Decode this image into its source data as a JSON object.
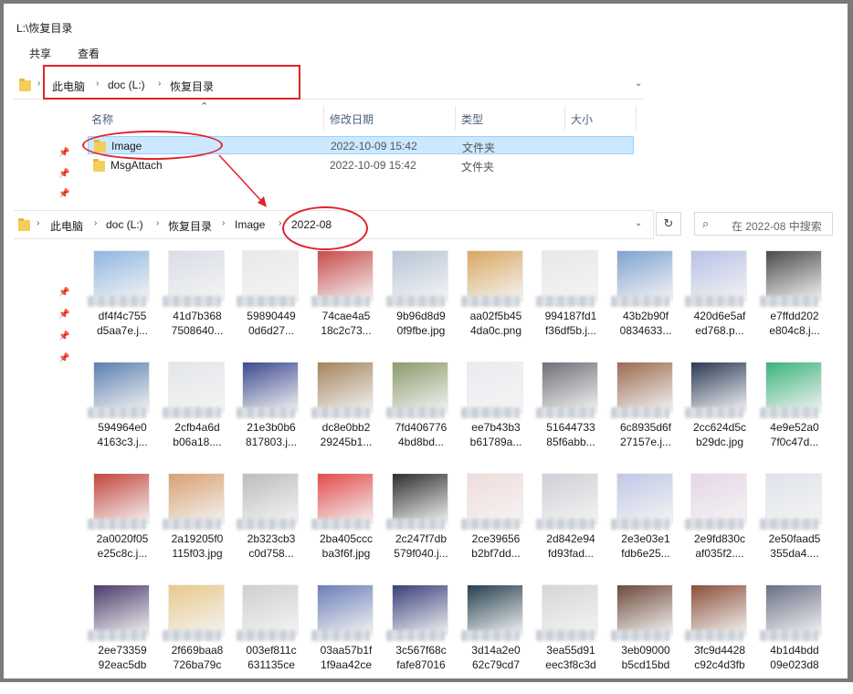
{
  "window": {
    "title": "L:\\恢复目录"
  },
  "ribbon": {
    "tabs": [
      "共享",
      "查看"
    ]
  },
  "top_address": {
    "segments": [
      "此电脑",
      "doc (L:)",
      "恢复目录"
    ]
  },
  "columns": {
    "name": "名称",
    "modified": "修改日期",
    "type": "类型",
    "size": "大小"
  },
  "files": [
    {
      "name": "Image",
      "modified": "2022-10-09 15:42",
      "type": "文件夹",
      "selected": true
    },
    {
      "name": "MsgAttach",
      "modified": "2022-10-09 15:42",
      "type": "文件夹",
      "selected": false
    }
  ],
  "bottom_address": {
    "segments": [
      "此电脑",
      "doc (L:)",
      "恢复目录",
      "Image",
      "2022-08"
    ]
  },
  "search": {
    "placeholder": "在 2022-08 中搜索"
  },
  "thumbnails": [
    {
      "l1": "df4f4c755",
      "l2": "d5aa7e.j...",
      "color": "#8fb7e0"
    },
    {
      "l1": "41d7b368",
      "l2": "7508640...",
      "color": "#d9dde6"
    },
    {
      "l1": "59890449",
      "l2": "0d6d27...",
      "color": "#e9e9e9"
    },
    {
      "l1": "74cae4a5",
      "l2": "18c2c73...",
      "color": "#c94b4b"
    },
    {
      "l1": "9b96d8d9",
      "l2": "0f9fbe.jpg",
      "color": "#b8c6d6"
    },
    {
      "l1": "aa02f5b45",
      "l2": "4da0c.png",
      "color": "#d9a861"
    },
    {
      "l1": "994187fd1",
      "l2": "f36df5b.j...",
      "color": "#e8e8e8"
    },
    {
      "l1": "43b2b90f",
      "l2": "0834633...",
      "color": "#7fa3cf"
    },
    {
      "l1": "420d6e5af",
      "l2": "ed768.p...",
      "color": "#b7c1e6"
    },
    {
      "l1": "e7ffdd202",
      "l2": "e804c8.j...",
      "color": "#4a4a4a"
    },
    {
      "l1": "594964e0",
      "l2": "4163c3.j...",
      "color": "#5c7fb0"
    },
    {
      "l1": "2cfb4a6d",
      "l2": "b06a18....",
      "color": "#e3e6ea"
    },
    {
      "l1": "21e3b0b6",
      "l2": "817803.j...",
      "color": "#3d4a8f"
    },
    {
      "l1": "dc8e0bb2",
      "l2": "29245b1...",
      "color": "#a3845c"
    },
    {
      "l1": "7fd406776",
      "l2": "4bd8bd...",
      "color": "#8b9a6a"
    },
    {
      "l1": "ee7b43b3",
      "l2": "b61789a...",
      "color": "#eceaf0"
    },
    {
      "l1": "51644733",
      "l2": "85f6abb...",
      "color": "#6f6f78"
    },
    {
      "l1": "6c8935d6f",
      "l2": "27157e.j...",
      "color": "#9a6b4f"
    },
    {
      "l1": "2cc624d5c",
      "l2": "b29dc.jpg",
      "color": "#2b3a55"
    },
    {
      "l1": "4e9e52a0",
      "l2": "7f0c47d...",
      "color": "#3bb37a"
    },
    {
      "l1": "2a0020f05",
      "l2": "e25c8c.j...",
      "color": "#c4463c"
    },
    {
      "l1": "2a19205f0",
      "l2": "115f03.jpg",
      "color": "#d8a070"
    },
    {
      "l1": "2b323cb3",
      "l2": "c0d758...",
      "color": "#bdbdbd"
    },
    {
      "l1": "2ba405ccc",
      "l2": "ba3f6f.jpg",
      "color": "#e44a4a"
    },
    {
      "l1": "2c247f7db",
      "l2": "579f040.j...",
      "color": "#2e2e2e"
    },
    {
      "l1": "2ce39656",
      "l2": "b2bf7dd...",
      "color": "#f0dcdc"
    },
    {
      "l1": "2d842e94",
      "l2": "fd93fad...",
      "color": "#cfcfd6"
    },
    {
      "l1": "2e3e03e1",
      "l2": "fdb6e25...",
      "color": "#c0c8e6"
    },
    {
      "l1": "2e9fd830c",
      "l2": "af035f2....",
      "color": "#e6d6e6"
    },
    {
      "l1": "2e50faad5",
      "l2": "355da4....",
      "color": "#dfe3ea"
    },
    {
      "l1": "2ee73359",
      "l2": "92eac5db",
      "color": "#4b3b6a"
    },
    {
      "l1": "2f669baa8",
      "l2": "726ba79c",
      "color": "#e8c98a"
    },
    {
      "l1": "003ef811c",
      "l2": "631135ce",
      "color": "#cfcfcf"
    },
    {
      "l1": "03aa57b1f",
      "l2": "1f9aa42ce",
      "color": "#6b7fb8"
    },
    {
      "l1": "3c567f68c",
      "l2": "fafe87016",
      "color": "#39407a"
    },
    {
      "l1": "3d14a2e0",
      "l2": "62c79cd7",
      "color": "#25404f"
    },
    {
      "l1": "3ea55d91",
      "l2": "eec3f8c3d",
      "color": "#d6d6d6"
    },
    {
      "l1": "3eb09000",
      "l2": "b5cd15bd",
      "color": "#6d4a3a"
    },
    {
      "l1": "3fc9d4428",
      "l2": "c92c4d3fb",
      "color": "#8b4f3a"
    },
    {
      "l1": "4b1d4bdd",
      "l2": "09e023d8",
      "color": "#6a6f86"
    }
  ]
}
